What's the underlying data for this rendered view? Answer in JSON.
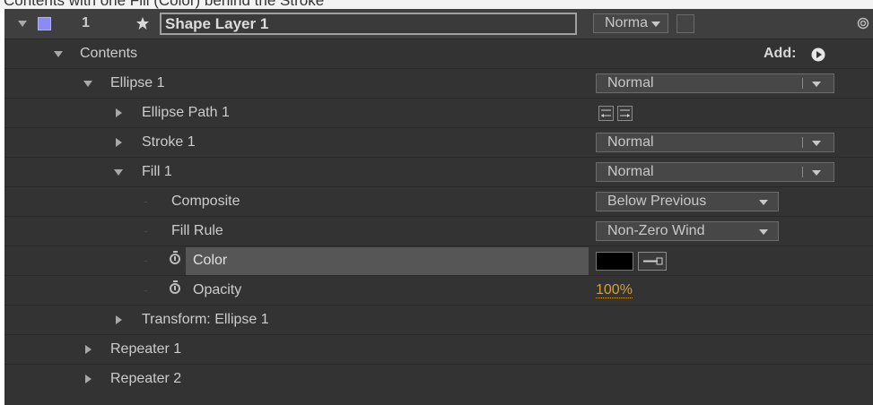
{
  "top_strip": {
    "text": "Contents with one Fill (Color) behind the Stroke"
  },
  "layer": {
    "number": "1",
    "name": "Shape Layer 1",
    "mode": "Norma",
    "label_color": "#8c8cf0"
  },
  "contents": {
    "label": "Contents",
    "add_label": "Add:"
  },
  "rows": {
    "ellipse1": {
      "label": "Ellipse 1",
      "mode": "Normal"
    },
    "ellipse_path": {
      "label": "Ellipse Path 1"
    },
    "stroke": {
      "label": "Stroke 1",
      "mode": "Normal"
    },
    "fill": {
      "label": "Fill 1",
      "mode": "Normal"
    },
    "composite": {
      "label": "Composite",
      "value": "Below Previous"
    },
    "fill_rule": {
      "label": "Fill Rule",
      "value": "Non-Zero Wind"
    },
    "color": {
      "label": "Color",
      "swatch": "#000000"
    },
    "opacity": {
      "label": "Opacity",
      "value": "100%",
      "value_color": "#d9a030"
    },
    "transform": {
      "label": "Transform: Ellipse 1"
    },
    "repeater1": {
      "label": "Repeater 1"
    },
    "repeater2": {
      "label": "Repeater 2"
    }
  }
}
